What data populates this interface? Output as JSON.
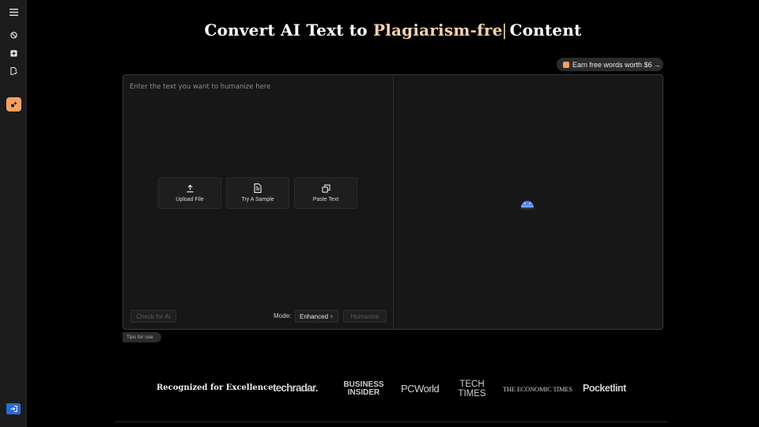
{
  "sidebar": {
    "items": [
      {
        "icon": "hamburger-menu-icon"
      },
      {
        "icon": "no-ai-icon"
      },
      {
        "icon": "plus-square-icon"
      },
      {
        "icon": "document-check-icon"
      },
      {
        "icon": "humanizer-sparkle-icon",
        "active": true
      },
      {
        "icon": "login-icon"
      }
    ],
    "active_color": "#f4a063",
    "login_color": "#2a6bd6"
  },
  "headline": {
    "prefix": "Convert AI Text to",
    "highlight": "Plagiarism-fre",
    "caret": "|",
    "suffix": "Content",
    "highlight_color": "#f6d2ae"
  },
  "earn": {
    "label": "Earn free words worth",
    "amount": "$6",
    "arrow": "→"
  },
  "editor": {
    "placeholder": "Enter the text you want to humanize here",
    "actions": [
      {
        "label": "Upload File",
        "icon": "upload-icon"
      },
      {
        "label": "Try A Sample",
        "icon": "document-icon"
      },
      {
        "label": "Paste Text",
        "icon": "copy-icon"
      }
    ],
    "check_ai_label": "Check for AI",
    "mode_label": "Mode:",
    "mode_value": "Enhanced",
    "humanize_label": "Humanize"
  },
  "tips": {
    "label": "Tips for use"
  },
  "recognized": {
    "label": "Recognized for Excellence:",
    "logos": {
      "techradar": "techradar.",
      "business_insider_1": "BUSINESS",
      "business_insider_2": "INSIDER",
      "pcworld": "PCWorld",
      "techtimes_1": "TECH",
      "techtimes_2": "TIMES",
      "economic_times": "THE ECONOMIC TIMES",
      "pocketlint": "Pocketlint"
    }
  }
}
